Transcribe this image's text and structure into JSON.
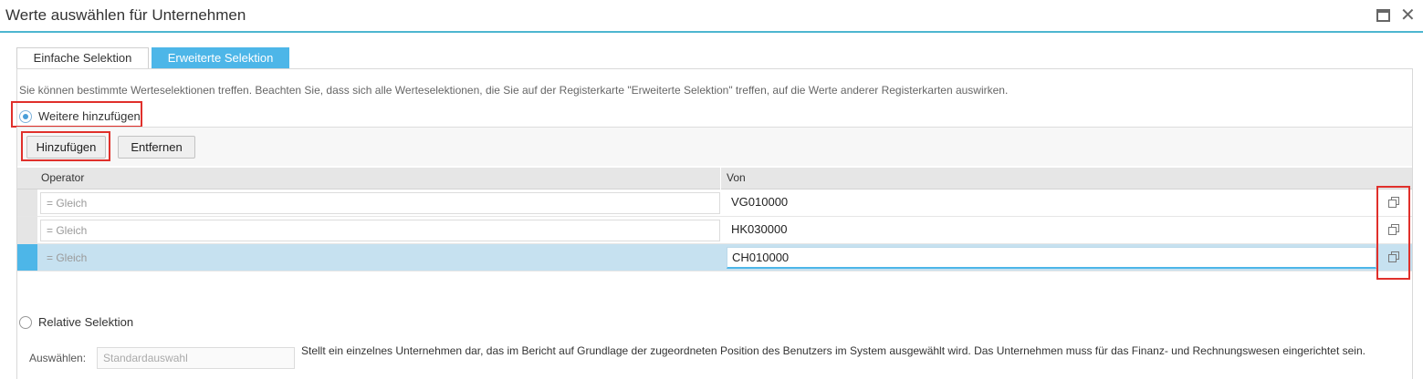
{
  "window": {
    "title": "Werte auswählen für Unternehmen",
    "maximize_icon": "maximize-icon",
    "close_glyph": "✕"
  },
  "tabs": [
    {
      "label": "Einfache Selektion",
      "active": false
    },
    {
      "label": "Erweiterte Selektion",
      "active": true
    }
  ],
  "info_text": "Sie können bestimmte Werteselektionen treffen. Beachten Sie, dass sich alle Werteselektionen, die Sie auf der Registerkarte \"Erweiterte Selektion\" treffen, auf die Werte anderer Registerkarten auswirken.",
  "options": {
    "add_more": {
      "label": "Weitere hinzufügen",
      "checked": true
    },
    "relative": {
      "label": "Relative Selektion",
      "checked": false
    }
  },
  "buttons": {
    "add": "Hinzufügen",
    "remove": "Entfernen"
  },
  "table": {
    "columns": [
      "Operator",
      "Von"
    ],
    "rows": [
      {
        "operator": "= Gleich",
        "von": "VG010000",
        "selected": false
      },
      {
        "operator": "= Gleich",
        "von": "HK030000",
        "selected": false
      },
      {
        "operator": "= Gleich",
        "von": "CH010000",
        "selected": true
      }
    ]
  },
  "relative": {
    "select_label": "Auswählen:",
    "select_placeholder": "Standardauswahl",
    "description": "Stellt ein einzelnes Unternehmen dar, das im Bericht auf Grundlage der zugeordneten Position des Benutzers im System ausgewählt wird. Das Unternehmen muss für das Finanz- und Rechnungswesen eingerichtet sein."
  },
  "colors": {
    "accent": "#4db6e8",
    "highlight": "#e0302b",
    "selected_row": "#c6e1f0"
  }
}
